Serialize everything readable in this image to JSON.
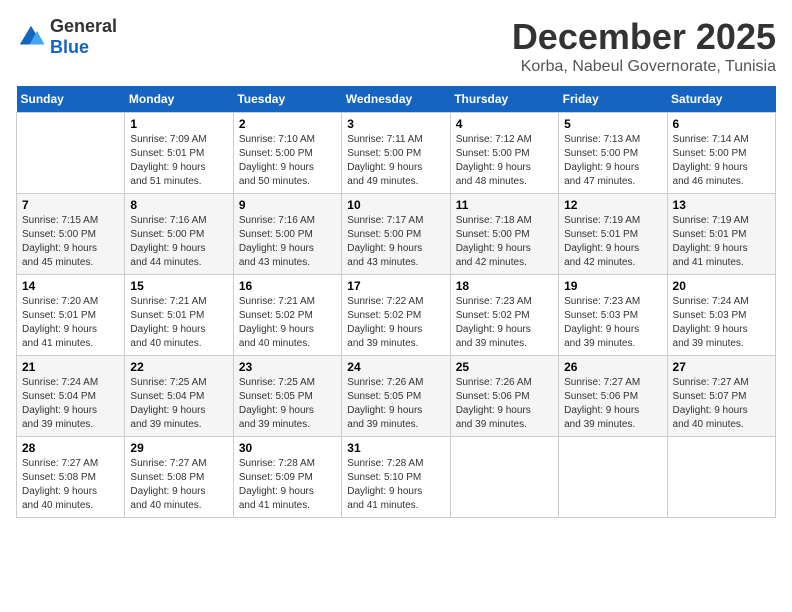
{
  "logo": {
    "general": "General",
    "blue": "Blue"
  },
  "title": "December 2025",
  "subtitle": "Korba, Nabeul Governorate, Tunisia",
  "days_of_week": [
    "Sunday",
    "Monday",
    "Tuesday",
    "Wednesday",
    "Thursday",
    "Friday",
    "Saturday"
  ],
  "weeks": [
    [
      {
        "day": "",
        "info": ""
      },
      {
        "day": "1",
        "info": "Sunrise: 7:09 AM\nSunset: 5:01 PM\nDaylight: 9 hours\nand 51 minutes."
      },
      {
        "day": "2",
        "info": "Sunrise: 7:10 AM\nSunset: 5:00 PM\nDaylight: 9 hours\nand 50 minutes."
      },
      {
        "day": "3",
        "info": "Sunrise: 7:11 AM\nSunset: 5:00 PM\nDaylight: 9 hours\nand 49 minutes."
      },
      {
        "day": "4",
        "info": "Sunrise: 7:12 AM\nSunset: 5:00 PM\nDaylight: 9 hours\nand 48 minutes."
      },
      {
        "day": "5",
        "info": "Sunrise: 7:13 AM\nSunset: 5:00 PM\nDaylight: 9 hours\nand 47 minutes."
      },
      {
        "day": "6",
        "info": "Sunrise: 7:14 AM\nSunset: 5:00 PM\nDaylight: 9 hours\nand 46 minutes."
      }
    ],
    [
      {
        "day": "7",
        "info": "Sunrise: 7:15 AM\nSunset: 5:00 PM\nDaylight: 9 hours\nand 45 minutes."
      },
      {
        "day": "8",
        "info": "Sunrise: 7:16 AM\nSunset: 5:00 PM\nDaylight: 9 hours\nand 44 minutes."
      },
      {
        "day": "9",
        "info": "Sunrise: 7:16 AM\nSunset: 5:00 PM\nDaylight: 9 hours\nand 43 minutes."
      },
      {
        "day": "10",
        "info": "Sunrise: 7:17 AM\nSunset: 5:00 PM\nDaylight: 9 hours\nand 43 minutes."
      },
      {
        "day": "11",
        "info": "Sunrise: 7:18 AM\nSunset: 5:00 PM\nDaylight: 9 hours\nand 42 minutes."
      },
      {
        "day": "12",
        "info": "Sunrise: 7:19 AM\nSunset: 5:01 PM\nDaylight: 9 hours\nand 42 minutes."
      },
      {
        "day": "13",
        "info": "Sunrise: 7:19 AM\nSunset: 5:01 PM\nDaylight: 9 hours\nand 41 minutes."
      }
    ],
    [
      {
        "day": "14",
        "info": "Sunrise: 7:20 AM\nSunset: 5:01 PM\nDaylight: 9 hours\nand 41 minutes."
      },
      {
        "day": "15",
        "info": "Sunrise: 7:21 AM\nSunset: 5:01 PM\nDaylight: 9 hours\nand 40 minutes."
      },
      {
        "day": "16",
        "info": "Sunrise: 7:21 AM\nSunset: 5:02 PM\nDaylight: 9 hours\nand 40 minutes."
      },
      {
        "day": "17",
        "info": "Sunrise: 7:22 AM\nSunset: 5:02 PM\nDaylight: 9 hours\nand 39 minutes."
      },
      {
        "day": "18",
        "info": "Sunrise: 7:23 AM\nSunset: 5:02 PM\nDaylight: 9 hours\nand 39 minutes."
      },
      {
        "day": "19",
        "info": "Sunrise: 7:23 AM\nSunset: 5:03 PM\nDaylight: 9 hours\nand 39 minutes."
      },
      {
        "day": "20",
        "info": "Sunrise: 7:24 AM\nSunset: 5:03 PM\nDaylight: 9 hours\nand 39 minutes."
      }
    ],
    [
      {
        "day": "21",
        "info": "Sunrise: 7:24 AM\nSunset: 5:04 PM\nDaylight: 9 hours\nand 39 minutes."
      },
      {
        "day": "22",
        "info": "Sunrise: 7:25 AM\nSunset: 5:04 PM\nDaylight: 9 hours\nand 39 minutes."
      },
      {
        "day": "23",
        "info": "Sunrise: 7:25 AM\nSunset: 5:05 PM\nDaylight: 9 hours\nand 39 minutes."
      },
      {
        "day": "24",
        "info": "Sunrise: 7:26 AM\nSunset: 5:05 PM\nDaylight: 9 hours\nand 39 minutes."
      },
      {
        "day": "25",
        "info": "Sunrise: 7:26 AM\nSunset: 5:06 PM\nDaylight: 9 hours\nand 39 minutes."
      },
      {
        "day": "26",
        "info": "Sunrise: 7:27 AM\nSunset: 5:06 PM\nDaylight: 9 hours\nand 39 minutes."
      },
      {
        "day": "27",
        "info": "Sunrise: 7:27 AM\nSunset: 5:07 PM\nDaylight: 9 hours\nand 40 minutes."
      }
    ],
    [
      {
        "day": "28",
        "info": "Sunrise: 7:27 AM\nSunset: 5:08 PM\nDaylight: 9 hours\nand 40 minutes."
      },
      {
        "day": "29",
        "info": "Sunrise: 7:27 AM\nSunset: 5:08 PM\nDaylight: 9 hours\nand 40 minutes."
      },
      {
        "day": "30",
        "info": "Sunrise: 7:28 AM\nSunset: 5:09 PM\nDaylight: 9 hours\nand 41 minutes."
      },
      {
        "day": "31",
        "info": "Sunrise: 7:28 AM\nSunset: 5:10 PM\nDaylight: 9 hours\nand 41 minutes."
      },
      {
        "day": "",
        "info": ""
      },
      {
        "day": "",
        "info": ""
      },
      {
        "day": "",
        "info": ""
      }
    ]
  ]
}
